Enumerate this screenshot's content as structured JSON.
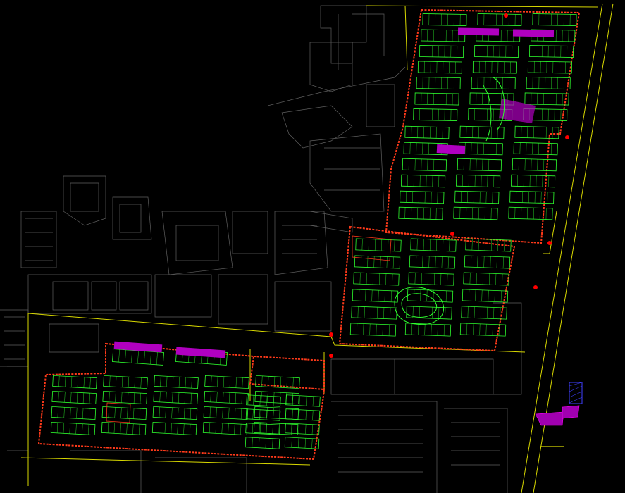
{
  "colors": {
    "background": "#000000",
    "context_lines": "#5f5f5f",
    "road_lines": "#d8d800",
    "site_boundary": "#ff3a1a",
    "buildings": "#2eff2e",
    "highlight": "#b000c0",
    "markers": "#ff0000"
  },
  "legend": {
    "boundary_label": "",
    "phase_labels": [
      "",
      ""
    ],
    "notes": ""
  }
}
